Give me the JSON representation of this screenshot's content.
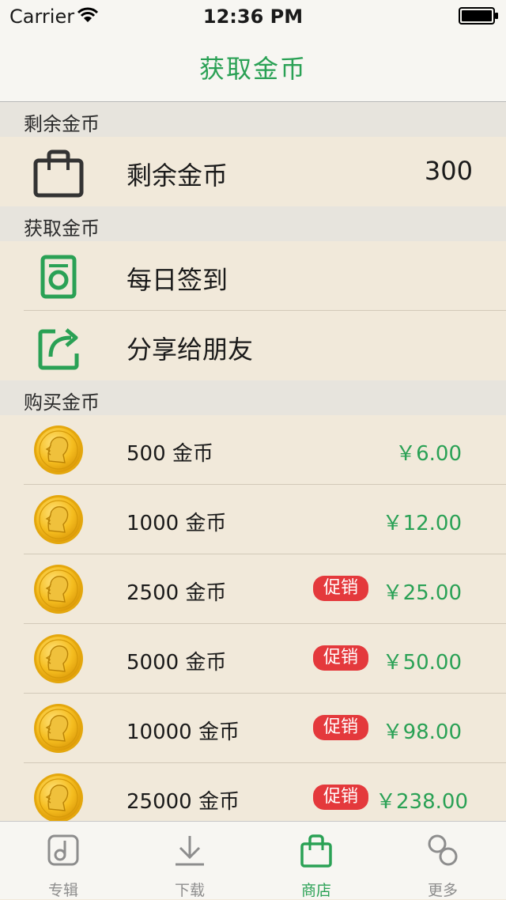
{
  "status_bar": {
    "carrier": "Carrier",
    "time": "12:36 PM"
  },
  "nav": {
    "title": "获取金币"
  },
  "sections": {
    "remaining": {
      "header": "剩余金币",
      "label": "剩余金币",
      "value": "300"
    },
    "earn": {
      "header": "获取金币",
      "items": [
        {
          "label": "每日签到",
          "icon": "checkin-icon"
        },
        {
          "label": "分享给朋友",
          "icon": "share-icon"
        }
      ]
    },
    "buy": {
      "header": "购买金币",
      "items": [
        {
          "label": "500 金币",
          "price": "￥6.00",
          "promo": ""
        },
        {
          "label": "1000 金币",
          "price": "￥12.00",
          "promo": ""
        },
        {
          "label": "2500 金币",
          "price": "￥25.00",
          "promo": "促销"
        },
        {
          "label": "5000 金币",
          "price": "￥50.00",
          "promo": "促销"
        },
        {
          "label": "10000 金币",
          "price": "￥98.00",
          "promo": "促销"
        },
        {
          "label": "25000 金币",
          "price": "￥238.00",
          "promo": "促销"
        }
      ]
    }
  },
  "tab_bar": {
    "tabs": [
      {
        "label": "专辑",
        "icon": "album-icon"
      },
      {
        "label": "下载",
        "icon": "download-icon"
      },
      {
        "label": "商店",
        "icon": "store-bag-icon",
        "active": true
      },
      {
        "label": "更多",
        "icon": "more-icon"
      }
    ]
  },
  "colors": {
    "accent": "#2aa155",
    "promo": "#e4393c",
    "background": "#f1e9da",
    "section_header": "#e7e4dd"
  }
}
